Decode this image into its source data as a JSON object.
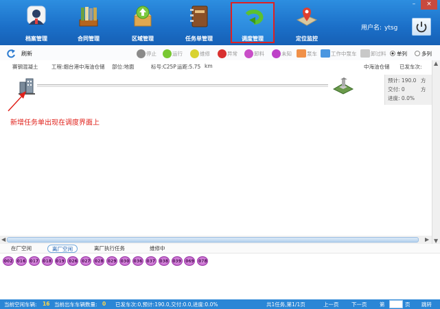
{
  "nav": {
    "items": [
      {
        "label": "档案管理",
        "icon": "archive-user-icon"
      },
      {
        "label": "合同管理",
        "icon": "books-icon"
      },
      {
        "label": "区域管理",
        "icon": "box-upload-icon"
      },
      {
        "label": "任务单管理",
        "icon": "notebook-icon"
      },
      {
        "label": "调度管理",
        "icon": "green-circular-arrow-icon"
      },
      {
        "label": "定位监控",
        "icon": "map-pin-icon"
      }
    ],
    "active": "调度管理"
  },
  "window": {
    "minimize": "–",
    "close": "×"
  },
  "user": {
    "label": "用户名:",
    "name": "ytsg"
  },
  "toolbar": {
    "refresh_label": "刷新",
    "legend": [
      {
        "label": "停止",
        "color": "#8a8a8a"
      },
      {
        "label": "运行",
        "color": "#78c832"
      },
      {
        "label": "维修",
        "color": "#d8d230"
      },
      {
        "label": "异常",
        "color": "#d83030"
      },
      {
        "label": "卸料",
        "color": "#c84ec8"
      },
      {
        "label": "未知",
        "color": "#bd40c8"
      },
      {
        "label": "泵车",
        "color": "#f09048"
      },
      {
        "label": "工作中泵车",
        "color": "#4a96e0"
      },
      {
        "label": "卸过料",
        "color": "#c8c8c8"
      }
    ],
    "view_single": "单列",
    "view_multi": "多列"
  },
  "task": {
    "company": "赛钢混凝土",
    "project": "工程:烟台港中海油仓储",
    "part": "部位:地面",
    "grade": "标号:C25P",
    "distance": "运距:5.75",
    "unit": "km",
    "site": "中海油仓储",
    "dispatched": "已发车次:",
    "plan_label": "预计:",
    "plan_value": "190.0",
    "delivered_label": "交付:",
    "delivered_value": "0",
    "progress_label": "进度:",
    "progress_value": "0.0%",
    "volume_unit": "方"
  },
  "annotation": "新增任务单出现在调度界面上",
  "tabs": {
    "in_plant": "在厂空闲",
    "out_idle": "离厂空闲",
    "out_task": "离厂执行任务",
    "repair": "维修中"
  },
  "vehicles": [
    "002",
    "016",
    "017",
    "018",
    "019",
    "026",
    "027",
    "028",
    "029",
    "030",
    "036",
    "037",
    "038",
    "039",
    "069",
    "078"
  ],
  "status": {
    "idle_label": "当前空闲车辆:",
    "idle_count": "16",
    "out_label": "当前出车车辆数量:",
    "out_count": "0",
    "summary": "已发车次:0,预计:190.0,交付:0.0,进度:0.0%",
    "page_info": "共1任务,第1/1页",
    "prev": "上一页",
    "next": "下一页",
    "page_prefix": "第",
    "page_suffix": "页",
    "jump": "跳转"
  }
}
